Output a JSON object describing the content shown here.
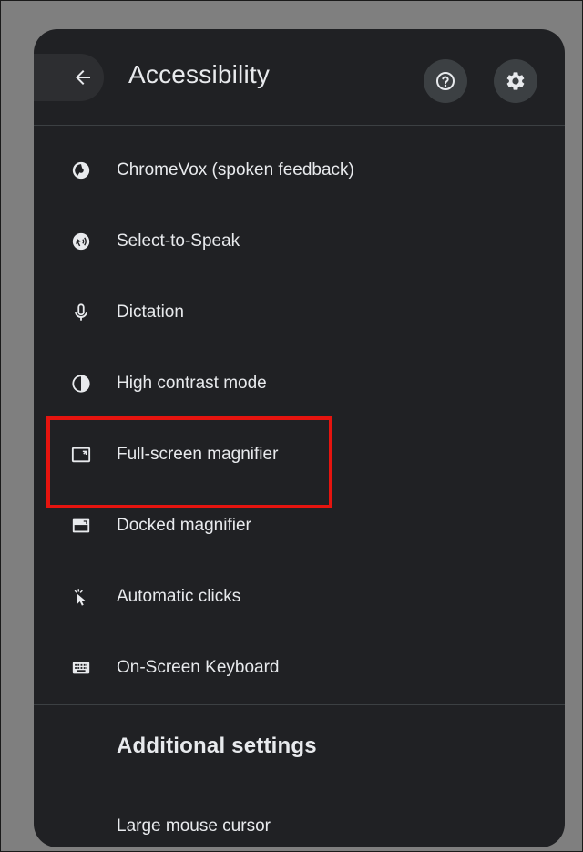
{
  "header": {
    "title": "Accessibility",
    "back_icon": "arrow-back-icon",
    "help_icon": "help-circle-icon",
    "settings_icon": "gear-icon"
  },
  "items": [
    {
      "label": "ChromeVox (spoken feedback)",
      "icon": "chromevox-icon"
    },
    {
      "label": "Select-to-Speak",
      "icon": "select-to-speak-icon"
    },
    {
      "label": "Dictation",
      "icon": "microphone-icon"
    },
    {
      "label": "High contrast mode",
      "icon": "contrast-icon"
    },
    {
      "label": "Full-screen magnifier",
      "icon": "fullscreen-magnifier-icon"
    },
    {
      "label": "Docked magnifier",
      "icon": "docked-magnifier-icon"
    },
    {
      "label": "Automatic clicks",
      "icon": "automatic-clicks-icon"
    },
    {
      "label": "On-Screen Keyboard",
      "icon": "keyboard-icon"
    }
  ],
  "additional": {
    "title": "Additional settings",
    "items": [
      {
        "label": "Large mouse cursor"
      }
    ]
  },
  "colors": {
    "panel_bg": "#202124",
    "text": "#e8eaed",
    "highlight": "#e5140f",
    "page_bg": "#7f7f7f"
  }
}
